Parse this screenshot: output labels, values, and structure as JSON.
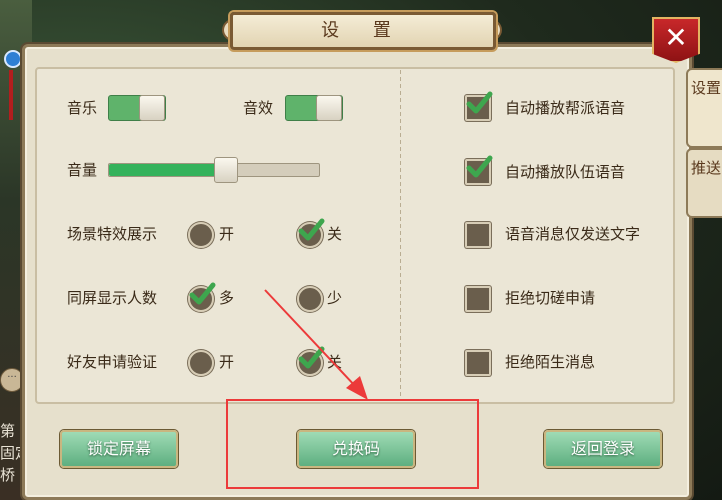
{
  "window": {
    "title": "设 置",
    "close_label": "✕"
  },
  "side_tabs": [
    {
      "label": "设置",
      "active": true
    },
    {
      "label": "推送",
      "active": false
    }
  ],
  "left_settings": {
    "music": {
      "label": "音乐",
      "on": true
    },
    "sound_effect": {
      "label": "音效",
      "on": true
    },
    "volume": {
      "label": "音量",
      "value": 0.55
    },
    "scene_effects": {
      "label": "场景特效展示",
      "options": [
        "开",
        "关"
      ],
      "selected": "关"
    },
    "same_screen_count": {
      "label": "同屏显示人数",
      "options": [
        "多",
        "少"
      ],
      "selected": "多"
    },
    "friend_verify": {
      "label": "好友申请验证",
      "options": [
        "开",
        "关"
      ],
      "selected": "关"
    }
  },
  "right_settings": [
    {
      "label": "自动播放帮派语音",
      "checked": true
    },
    {
      "label": "自动播放队伍语音",
      "checked": true
    },
    {
      "label": "语音消息仅发送文字",
      "checked": false
    },
    {
      "label": "拒绝切磋申请",
      "checked": false
    },
    {
      "label": "拒绝陌生消息",
      "checked": false
    }
  ],
  "buttons": {
    "lock_screen": "锁定屏幕",
    "redeem_code": "兑换码",
    "back_to_login": "返回登录"
  },
  "background_text": [
    "第",
    "固定",
    "桥"
  ],
  "colors": {
    "toggle_on": "#5fb36b",
    "slider_fill": "#34b25b",
    "annotation": "#ec3a3a",
    "close_red": "#c8282a"
  }
}
